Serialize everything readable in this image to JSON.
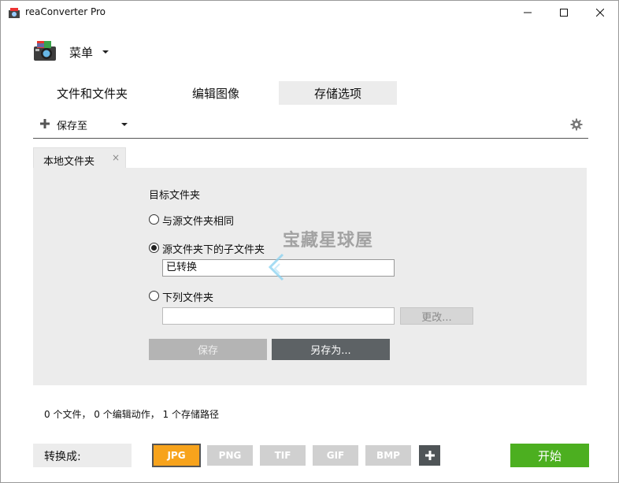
{
  "window": {
    "title": "reaConverter Pro"
  },
  "menu": {
    "label": "菜单"
  },
  "main_tabs": [
    {
      "label": "文件和文件夹"
    },
    {
      "label": "编辑图像"
    },
    {
      "label": "存储选项"
    }
  ],
  "toolbar": {
    "save_to_label": "保存至"
  },
  "sub_tab": {
    "label": "本地文件夹",
    "close": "×"
  },
  "destination": {
    "section_label": "目标文件夹",
    "options": [
      {
        "label": "与源文件夹相同",
        "selected": false
      },
      {
        "label": "源文件夹下的子文件夹",
        "selected": true
      },
      {
        "label": "下列文件夹",
        "selected": false
      }
    ],
    "subfolder_value": "已转换",
    "folder_value": "",
    "change_label": "更改...",
    "save_label": "保存",
    "save_as_label": "另存为..."
  },
  "watermark": {
    "text": "宝藏星球屋"
  },
  "status": {
    "text": "0 个文件， 0 个编辑动作， 1 个存储路径"
  },
  "bottom": {
    "convert_label": "转换成:",
    "formats": [
      "JPG",
      "PNG",
      "TIF",
      "GIF",
      "BMP"
    ],
    "selected_format": "JPG",
    "start_label": "开始"
  },
  "colors": {
    "accent_orange": "#f7a31c",
    "start_green": "#4caf20",
    "dark_button": "#5d6265",
    "panel_bg": "#ececec"
  }
}
